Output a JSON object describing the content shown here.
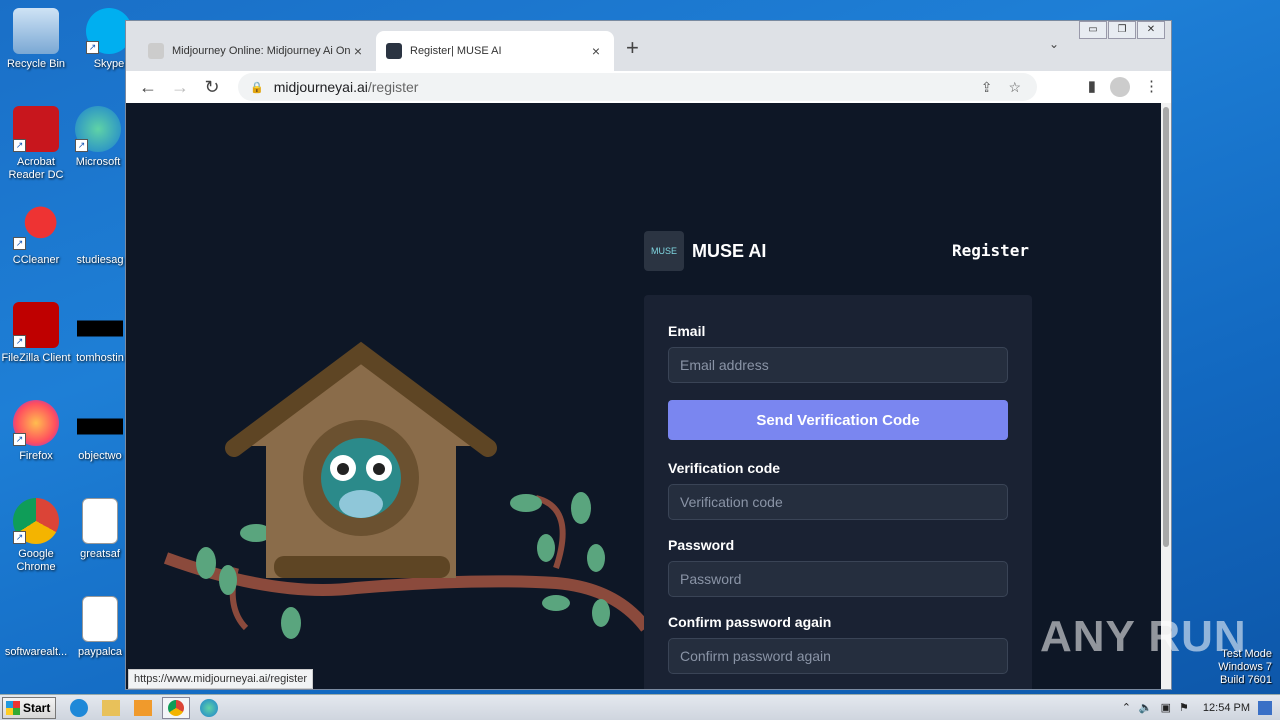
{
  "desktop": {
    "icons": [
      {
        "label": "Recycle Bin",
        "icon": "recycle-bin-icon"
      },
      {
        "label": "Skype",
        "icon": "skype-icon"
      },
      {
        "label": "Acrobat Reader DC",
        "icon": "acrobat-icon"
      },
      {
        "label": "Microsoft",
        "icon": "edge-icon"
      },
      {
        "label": "CCleaner",
        "icon": "ccleaner-icon"
      },
      {
        "label": "studiesag",
        "icon": "file-icon"
      },
      {
        "label": "FileZilla Client",
        "icon": "filezilla-icon"
      },
      {
        "label": "tomhostin",
        "icon": "file-icon"
      },
      {
        "label": "Firefox",
        "icon": "firefox-icon"
      },
      {
        "label": "objectwo",
        "icon": "file-icon"
      },
      {
        "label": "Google Chrome",
        "icon": "chrome-icon"
      },
      {
        "label": "greatsaf",
        "icon": "word-icon"
      },
      {
        "label": "softwarealt...",
        "icon": "file-icon"
      },
      {
        "label": "paypalca",
        "icon": "word-icon"
      }
    ]
  },
  "browser": {
    "tabs": [
      {
        "title": "Midjourney Online: Midjourney Ai Onl",
        "close": "×"
      },
      {
        "title": "Register| MUSE AI",
        "close": "×"
      }
    ],
    "new_tab": "+",
    "tab_menu": "⌄",
    "window_controls": [
      "▭",
      "❐",
      "✕"
    ],
    "url_domain": "midjourneyai.ai",
    "url_path": "/register",
    "hover_url": "https://www.midjourneyai.ai/register"
  },
  "page": {
    "brand_name": "MUSE AI",
    "logo_text": "MUSE",
    "heading": "Register",
    "form": {
      "email_label": "Email",
      "email_placeholder": "Email address",
      "send_button": "Send Verification Code",
      "code_label": "Verification code",
      "code_placeholder": "Verification code",
      "password_label": "Password",
      "password_placeholder": "Password",
      "confirm_label": "Confirm password again",
      "confirm_placeholder": "Confirm password again"
    }
  },
  "taskbar": {
    "start_label": "Start",
    "clock": "12:54 PM"
  },
  "watermark": {
    "line1": "Test Mode",
    "line2": "Windows 7",
    "line3": "Build 7601",
    "logo": "ANY RUN"
  }
}
